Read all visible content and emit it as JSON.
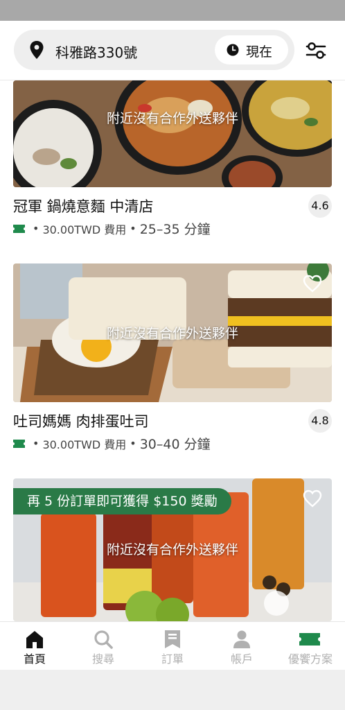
{
  "header": {
    "address": "科雅路330號",
    "time_label": "現在"
  },
  "stores": [
    {
      "overlay": "附近沒有合作外送夥伴",
      "name": "冠軍 鍋燒意麵 中清店",
      "rating": "4.6",
      "fee": "30.00TWD 費用",
      "eta": "25–35 分鐘"
    },
    {
      "overlay": "附近沒有合作外送夥伴",
      "name": "吐司媽媽 肉排蛋吐司",
      "rating": "4.8",
      "fee": "30.00TWD 費用",
      "eta": "30–40 分鐘"
    },
    {
      "overlay": "附近沒有合作外送夥伴",
      "promo": "再 5 份訂單即可獲得 $150 獎勵"
    }
  ],
  "tabs": [
    {
      "label": "首頁",
      "icon": "home-icon"
    },
    {
      "label": "搜尋",
      "icon": "search-icon"
    },
    {
      "label": "訂單",
      "icon": "receipt-icon"
    },
    {
      "label": "帳戶",
      "icon": "person-icon"
    },
    {
      "label": "優饗方案",
      "icon": "ticket-icon"
    }
  ],
  "colors": {
    "accent_green": "#1f8a4c",
    "promo_green": "#2a7a47",
    "inactive_tab": "#b0b0b0"
  }
}
